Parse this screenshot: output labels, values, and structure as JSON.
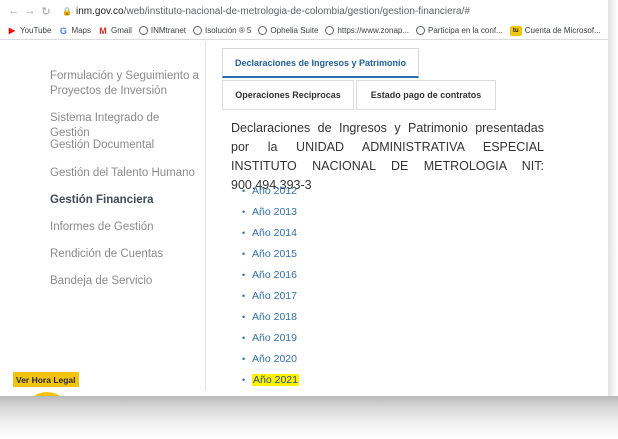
{
  "browser": {
    "url_host": "inm.gov.co",
    "url_path": "/web/instituto-nacional-de-metrologia-de-colombia/gestion/gestion-financiera/#",
    "bookmarks": [
      {
        "icon": "youtube-icon",
        "label": "YouTube"
      },
      {
        "icon": "google-icon",
        "label": "Maps"
      },
      {
        "icon": "gmail-icon",
        "label": "Gmail"
      },
      {
        "icon": "globe-icon",
        "label": "INMtranet"
      },
      {
        "icon": "globe-icon",
        "label": "Isolución ® 5"
      },
      {
        "icon": "globe-icon",
        "label": "Ophelia Suite"
      },
      {
        "icon": "globe-icon",
        "label": "https://www.zonap..."
      },
      {
        "icon": "globe-icon",
        "label": "Participa en la conf..."
      },
      {
        "icon": "tu-icon",
        "label": "Cuenta de Microsof..."
      }
    ]
  },
  "sidebar": {
    "items": [
      {
        "label": "Formulación y Seguimiento a Proyectos de Inversión",
        "active": false
      },
      {
        "label": "Sistema Integrado de Gestión",
        "active": false
      },
      {
        "label": "Gestión Documental",
        "active": false
      },
      {
        "label": "Gestión del Talento Humano",
        "active": false
      },
      {
        "label": "Gestión Financiera",
        "active": true
      },
      {
        "label": "Informes de Gestión",
        "active": false
      },
      {
        "label": "Rendición de Cuentas",
        "active": false
      },
      {
        "label": "Bandeja de Servicio",
        "active": false
      }
    ]
  },
  "tabs": [
    {
      "label": "Declaraciones de Ingresos y Patrimonio",
      "active": true
    },
    {
      "label": "Operaciones Reciprocas",
      "active": false
    },
    {
      "label": "Estado pago de contratos",
      "active": false
    }
  ],
  "content": {
    "heading": "Declaraciones de Ingresos y Patrimonio presentadas por la UNIDAD ADMINISTRATIVA ESPECIAL INSTITUTO NACIONAL DE METROLOGIA NIT: 900.494.393-3",
    "years": [
      {
        "label": "Año 2012",
        "highlighted": false
      },
      {
        "label": "Año 2013",
        "highlighted": false
      },
      {
        "label": "Año 2014",
        "highlighted": false
      },
      {
        "label": "Año 2015",
        "highlighted": false
      },
      {
        "label": "Año 2016",
        "highlighted": false
      },
      {
        "label": "Año 2017",
        "highlighted": false
      },
      {
        "label": "Año 2018",
        "highlighted": false
      },
      {
        "label": "Año 2019",
        "highlighted": false
      },
      {
        "label": "Año 2020",
        "highlighted": false
      },
      {
        "label": "Año 2021",
        "highlighted": true
      }
    ],
    "highlight_color": "#ffef00",
    "link_color": "#2f6fb0"
  },
  "legal_time": {
    "label": "Ver Hora Legal",
    "icon": "clock-icon",
    "accent": "#f2c311"
  }
}
